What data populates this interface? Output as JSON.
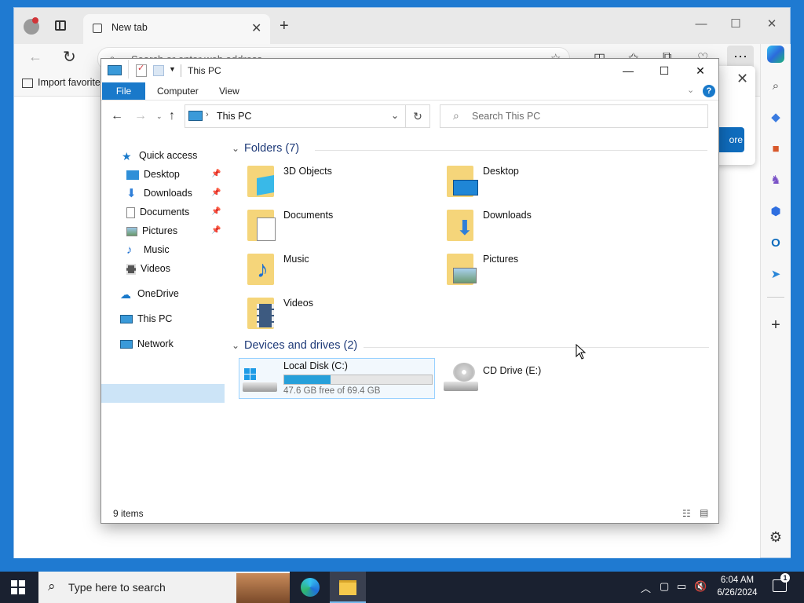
{
  "browser": {
    "tab_title": "New tab",
    "address_placeholder": "Search or enter web address",
    "favorites_item": "Import favorites",
    "popup_button": "ore",
    "window_controls": [
      "minimize",
      "restore",
      "close"
    ]
  },
  "explorer": {
    "title": "This PC",
    "ribbon_tabs": {
      "file": "File",
      "computer": "Computer",
      "view": "View"
    },
    "breadcrumb": "This PC",
    "search_placeholder": "Search This PC",
    "nav": {
      "quick_access": "Quick access",
      "items": [
        {
          "label": "Desktop",
          "pinned": true
        },
        {
          "label": "Downloads",
          "pinned": true
        },
        {
          "label": "Documents",
          "pinned": true
        },
        {
          "label": "Pictures",
          "pinned": true
        },
        {
          "label": "Music",
          "pinned": false
        },
        {
          "label": "Videos",
          "pinned": false
        }
      ],
      "onedrive": "OneDrive",
      "this_pc": "This PC",
      "network": "Network"
    },
    "folders_header": "Folders (7)",
    "folders": [
      "3D Objects",
      "Desktop",
      "Documents",
      "Downloads",
      "Music",
      "Pictures",
      "Videos"
    ],
    "devices_header": "Devices and drives (2)",
    "drives": {
      "c": {
        "name": "Local Disk (C:)",
        "free_text": "47.6 GB free of 69.4 GB",
        "used_fraction": 0.314
      },
      "e": {
        "name": "CD Drive (E:)"
      }
    },
    "status": "9 items"
  },
  "taskbar": {
    "search_placeholder": "Type here to search",
    "time": "6:04 AM",
    "date": "6/26/2024",
    "notification_count": "1"
  },
  "colors": {
    "accent": "#1979ca",
    "taskbar": "#1a2130",
    "desktop": "#1f7ad1",
    "selection": "#cce4f7",
    "drive_bar": "#26a0da"
  }
}
